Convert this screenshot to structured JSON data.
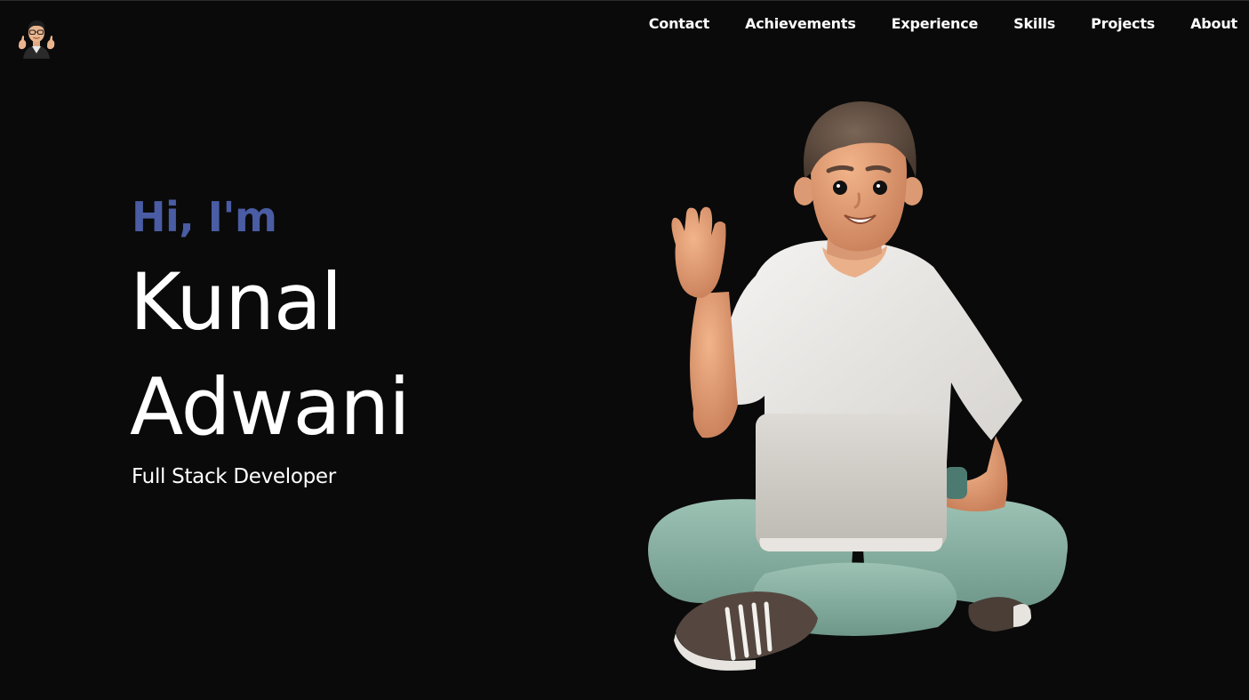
{
  "nav": {
    "items": [
      {
        "label": "Contact"
      },
      {
        "label": "Achievements"
      },
      {
        "label": "Experience"
      },
      {
        "label": "Skills"
      },
      {
        "label": "Projects"
      },
      {
        "label": "About"
      }
    ]
  },
  "logo": {
    "icon": "memoji-avatar-icon"
  },
  "hero": {
    "greeting": "Hi, I'm",
    "first_name": "Kunal",
    "last_name": "Adwani",
    "role": "Full Stack Developer",
    "illustration": "waving-person-with-laptop-illustration"
  },
  "colors": {
    "background": "#0a0a0a",
    "accent": "#4a5ca3",
    "text": "#ffffff"
  }
}
